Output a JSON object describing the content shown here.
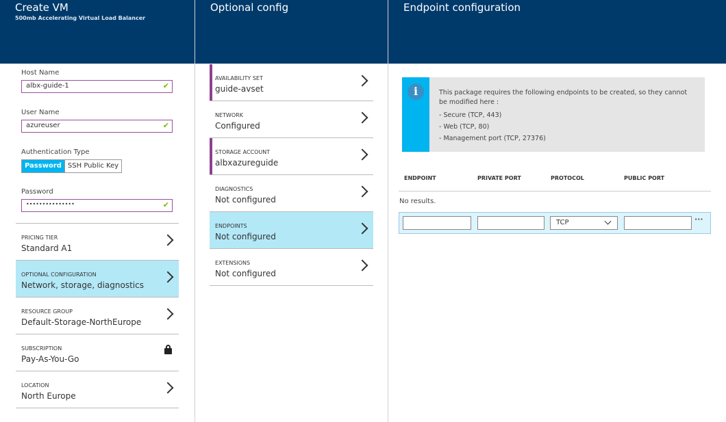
{
  "create_vm": {
    "title": "Create VM",
    "subtitle": "500mb Accelerating Virtual Load Balancer",
    "host_name_label": "Host Name",
    "host_name": "albx-guide-1",
    "user_name_label": "User Name",
    "user_name": "azureuser",
    "auth_label": "Authentication Type",
    "auth_options": [
      "Password",
      "SSH Public Key"
    ],
    "auth_selected": "Password",
    "password_label": "Password",
    "password": "•••••••••••••••",
    "items": [
      {
        "key": "PRICING TIER",
        "value": "Standard A1"
      },
      {
        "key": "OPTIONAL CONFIGURATION",
        "value": "Network, storage, diagnostics"
      },
      {
        "key": "RESOURCE GROUP",
        "value": "Default-Storage-NorthEurope"
      },
      {
        "key": "SUBSCRIPTION",
        "value": "Pay-As-You-Go",
        "icon": "lock-icon"
      },
      {
        "key": "LOCATION",
        "value": "North Europe"
      }
    ]
  },
  "optional_config": {
    "title": "Optional config",
    "items": [
      {
        "key": "AVAILABILITY SET",
        "value": "guide-avset"
      },
      {
        "key": "NETWORK",
        "value": "Configured"
      },
      {
        "key": "STORAGE ACCOUNT",
        "value": "albxazureguide"
      },
      {
        "key": "DIAGNOSTICS",
        "value": "Not configured"
      },
      {
        "key": "ENDPOINTS",
        "value": "Not configured"
      },
      {
        "key": "EXTENSIONS",
        "value": "Not configured"
      }
    ]
  },
  "endpoint_config": {
    "title": "Endpoint configuration",
    "info": "This package requires the following endpoints to be created, so they cannot be modified here :",
    "info_list": [
      "- Secure (TCP, 443)",
      "- Web (TCP, 80)",
      "- Management port (TCP, 27376)"
    ],
    "columns": [
      "ENDPOINT",
      "PRIVATE PORT",
      "PROTOCOL",
      "PUBLIC PORT"
    ],
    "empty": "No results.",
    "protocol_value": "TCP",
    "more": "···"
  },
  "colors": {
    "header": "#003a6b",
    "selected": "#b3e8f7",
    "accent": "#00b4f0",
    "required": "#8e3f90"
  }
}
